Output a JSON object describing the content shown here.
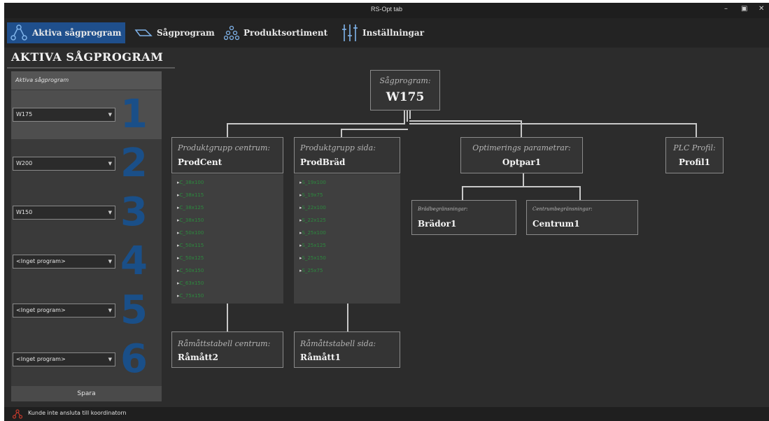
{
  "window": {
    "title": "RS-Opt tab"
  },
  "tabs": [
    {
      "label": "Aktiva sågprogram",
      "icon": "network-icon"
    },
    {
      "label": "Sågprogram",
      "icon": "saw-blade-icon"
    },
    {
      "label": "Produktsortiment",
      "icon": "product-stack-icon"
    },
    {
      "label": "Inställningar",
      "icon": "sliders-icon"
    }
  ],
  "page": {
    "heading": "AKTIVA SÅGPROGRAM"
  },
  "panel": {
    "header": "Aktiva sågprogram",
    "slots": [
      {
        "number": "1",
        "value": "W175"
      },
      {
        "number": "2",
        "value": "W200"
      },
      {
        "number": "3",
        "value": "W150"
      },
      {
        "number": "4",
        "value": "<Inget program>"
      },
      {
        "number": "5",
        "value": "<Inget program>"
      },
      {
        "number": "6",
        "value": "<Inget program>"
      }
    ],
    "save_label": "Spara"
  },
  "tree": {
    "root": {
      "label": "Sågprogram:",
      "value": "W175"
    },
    "prod_center": {
      "label": "Produktgrupp centrum:",
      "value": "ProdCent"
    },
    "prod_side": {
      "label": "Produktgrupp sida:",
      "value": "ProdBräd"
    },
    "optim": {
      "label": "Optimerings parametrar:",
      "value": "Optpar1"
    },
    "plc": {
      "label": "PLC Profil:",
      "value": "Profil1"
    },
    "board_limits": {
      "label": "Brädbegränsningar:",
      "value": "Brädor1"
    },
    "center_limits": {
      "label": "Centrumbegränsningar:",
      "value": "Centrum1"
    },
    "raw_center": {
      "label": "Råmåttstabell centrum:",
      "value": "Råmått2"
    },
    "raw_side": {
      "label": "Råmåttstabell sida:",
      "value": "Råmått1"
    }
  },
  "status": {
    "message": "Kunde inte ansluta till koordinatorn",
    "icon": "network-error-icon"
  },
  "colors": {
    "accent": "#1f4f8c",
    "number": "#1a4f88",
    "list_item": "#2c8a3e",
    "background": "#2c2c2c"
  }
}
